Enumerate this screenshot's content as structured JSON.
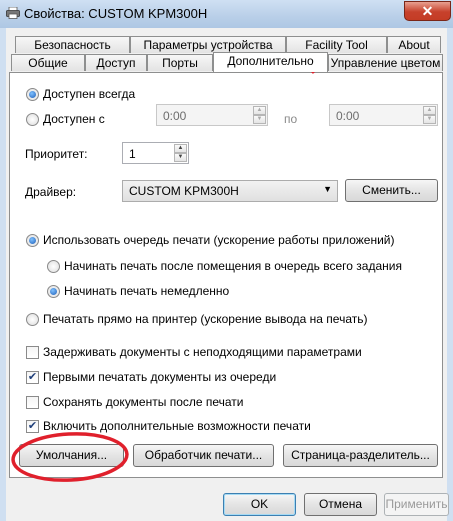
{
  "window": {
    "title": "Свойства: CUSTOM KPM300H",
    "close_label": "✕"
  },
  "tabs_row1": [
    "Безопасность",
    "Параметры устройства",
    "Facility Tool",
    "About"
  ],
  "tabs_row2": [
    "Общие",
    "Доступ",
    "Порты",
    "Дополнительно",
    "Управление цветом"
  ],
  "active_tab": "Дополнительно",
  "availability": {
    "always_label": "Доступен всегда",
    "from_label": "Доступен с",
    "from_time": "0:00",
    "to_label": "по",
    "to_time": "0:00",
    "selected": "always"
  },
  "priority": {
    "label": "Приоритет:",
    "value": "1"
  },
  "driver": {
    "label": "Драйвер:",
    "value": "CUSTOM KPM300H",
    "change_button": "Сменить..."
  },
  "spool": {
    "use_spool_label": "Использовать очередь печати (ускорение работы приложений)",
    "after_last_page_label": "Начинать печать после помещения в очередь всего задания",
    "immediately_label": "Начинать печать немедленно",
    "direct_label": "Печатать прямо на принтер (ускорение вывода на печать)"
  },
  "options": [
    {
      "label": "Задерживать документы с неподходящими параметрами",
      "checked": false
    },
    {
      "label": "Первыми печатать документы из очереди",
      "checked": true
    },
    {
      "label": "Сохранять документы после печати",
      "checked": false
    },
    {
      "label": "Включить дополнительные возможности печати",
      "checked": true
    }
  ],
  "panel_buttons": {
    "defaults": "Умолчания...",
    "print_processor": "Обработчик печати...",
    "separator_page": "Страница-разделитель..."
  },
  "dialog_buttons": {
    "ok": "OK",
    "cancel": "Отмена",
    "apply": "Применить"
  },
  "annotations": {
    "checkmark_color": "#e0202c",
    "circle_color": "#e0202c"
  }
}
